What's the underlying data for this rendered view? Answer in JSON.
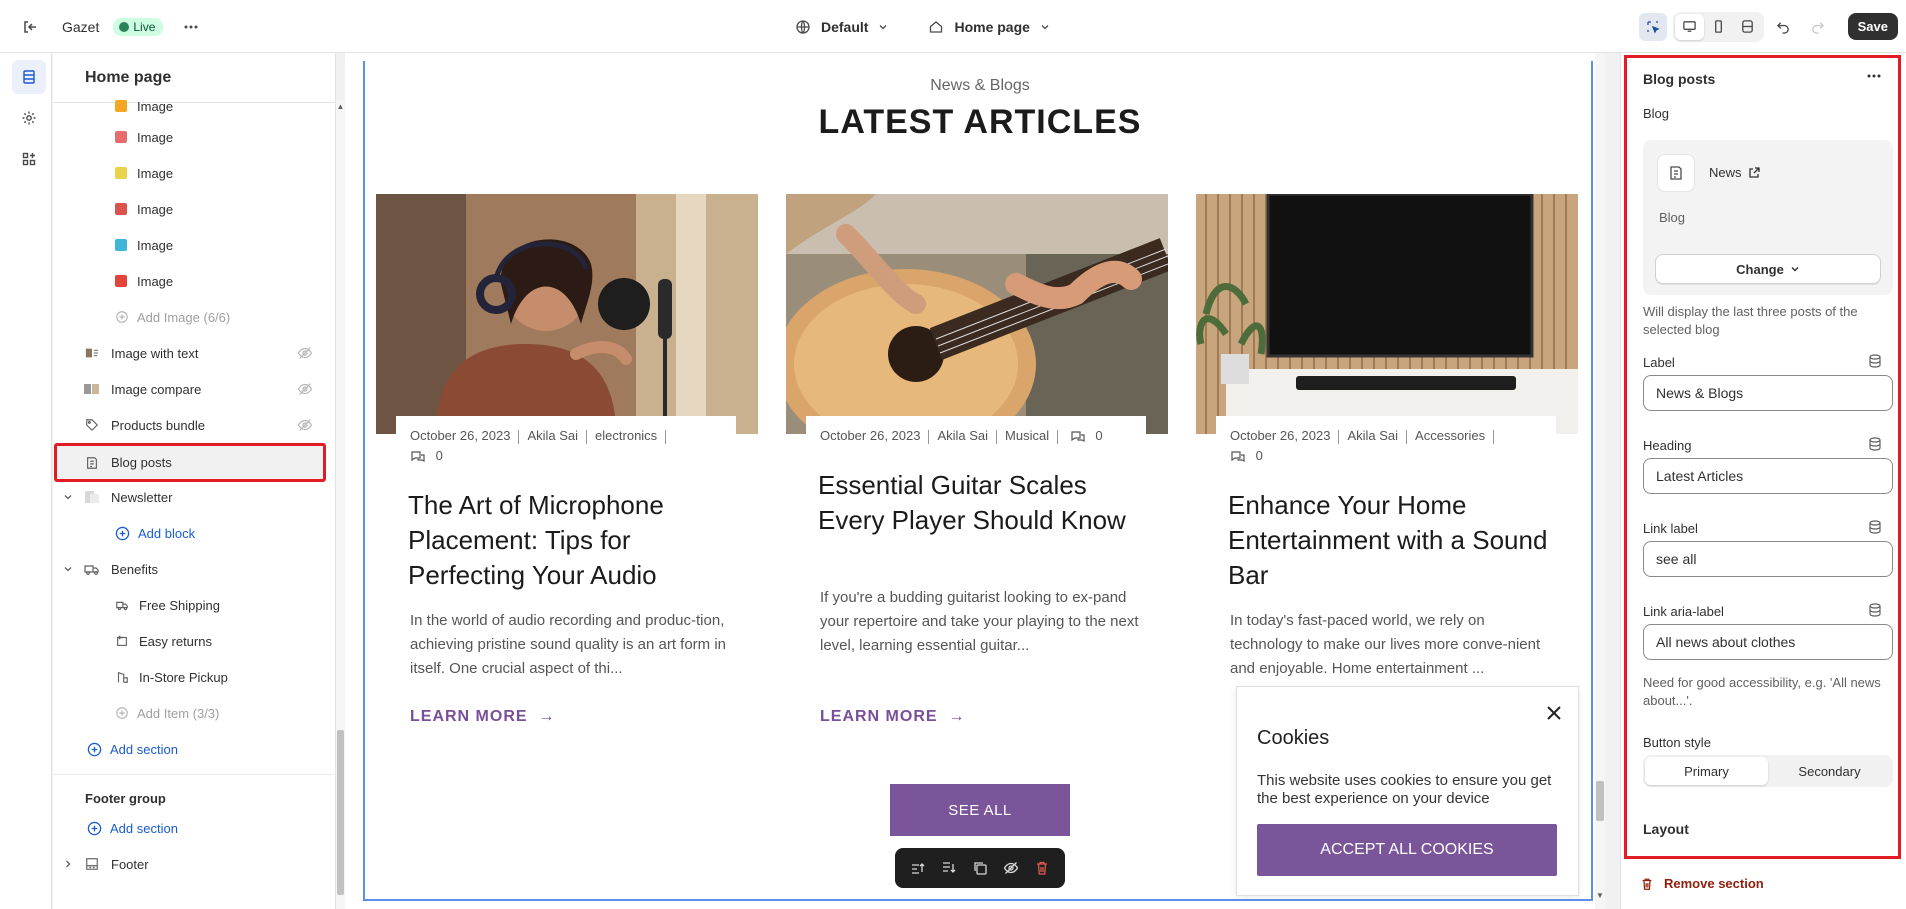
{
  "topbar": {
    "store_name": "Gazet",
    "live_label": "Live",
    "theme_label": "Default",
    "page_label": "Home page",
    "save_label": "Save"
  },
  "sidebar": {
    "title": "Home page",
    "image_blocks": [
      {
        "label": "Image",
        "color": "#f5a623"
      },
      {
        "label": "Image",
        "color": "#e86c6c"
      },
      {
        "label": "Image",
        "color": "#e8d34a"
      },
      {
        "label": "Image",
        "color": "#d9534f"
      },
      {
        "label": "Image",
        "color": "#3fb6d8"
      },
      {
        "label": "Image",
        "color": "#e0443a"
      }
    ],
    "add_image": "Add Image (6/6)",
    "image_with_text": "Image with text",
    "image_compare": "Image compare",
    "products_bundle": "Products bundle",
    "blog_posts": "Blog posts",
    "newsletter": "Newsletter",
    "add_block": "Add block",
    "benefits": "Benefits",
    "free_shipping": "Free Shipping",
    "easy_returns": "Easy returns",
    "in_store_pickup": "In-Store Pickup",
    "add_item": "Add Item (3/3)",
    "add_section": "Add section",
    "footer_group": "Footer group",
    "add_section_footer": "Add section",
    "footer": "Footer"
  },
  "preview": {
    "subheading": "News & Blogs",
    "heading": "LATEST ARTICLES",
    "cards": [
      {
        "date": "October 26, 2023",
        "author": "Akila Sai",
        "tag": "electronics",
        "comments": "0",
        "title": "The Art of Microphone Placement: Tips for Perfecting Your Audio",
        "excerpt": "In the world of audio recording and produc-tion, achieving pristine sound quality is an art form in itself. One crucial aspect of thi...",
        "learn_more": "LEARN MORE"
      },
      {
        "date": "October 26, 2023",
        "author": "Akila Sai",
        "tag": "Musical",
        "comments": "0",
        "title": "Essential Guitar Scales Every Player Should Know",
        "excerpt": "If you're a budding guitarist looking to ex-pand your repertoire and take your playing to the next level, learning essential guitar...",
        "learn_more": "LEARN MORE"
      },
      {
        "date": "October 26, 2023",
        "author": "Akila Sai",
        "tag": "Accessories",
        "comments": "0",
        "title": "Enhance Your Home Entertainment with a Sound Bar",
        "excerpt": "In today's fast-paced world, we rely on technology to make our lives more conve-nient and enjoyable. Home entertainment ...",
        "learn_more": "LEARN MORE"
      }
    ],
    "see_all": "SEE ALL",
    "cookie": {
      "title": "Cookies",
      "text": "This website uses cookies to ensure you get the best experience on your device",
      "accept": "ACCEPT ALL COOKIES"
    }
  },
  "settings": {
    "title": "Blog posts",
    "blog_label": "Blog",
    "blog_name": "News",
    "blog_sub": "Blog",
    "change_label": "Change",
    "blog_help": "Will display the last three posts of the selected blog",
    "label_label": "Label",
    "label_value": "News & Blogs",
    "heading_label": "Heading",
    "heading_value": "Latest Articles",
    "link_label_label": "Link label",
    "link_label_value": "see all",
    "aria_label": "Link aria-label",
    "aria_value": "All news about clothes",
    "aria_help": "Need for good accessibility, e.g. 'All news about...'.",
    "button_style_label": "Button style",
    "primary": "Primary",
    "secondary": "Secondary",
    "layout": "Layout",
    "remove": "Remove section"
  },
  "colors": {
    "accent": "#7a559a",
    "highlight": "#e31b23",
    "link": "#1a5bd1"
  }
}
